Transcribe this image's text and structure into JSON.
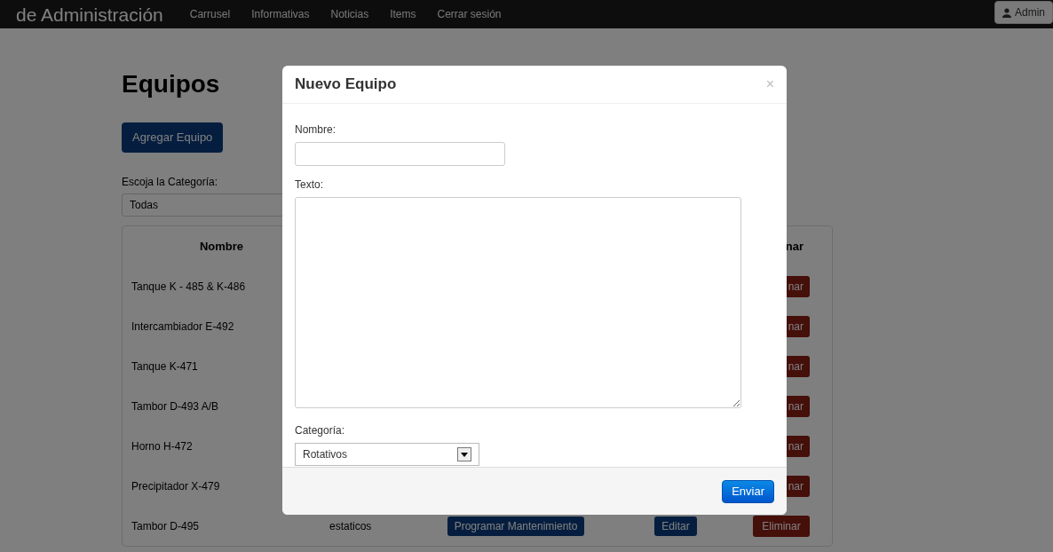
{
  "navbar": {
    "brand": "de Administración",
    "links": [
      "Carrusel",
      "Informativas",
      "Noticias",
      "Items",
      "Cerrar sesión"
    ],
    "user": "Admin"
  },
  "page": {
    "title": "Equipos",
    "add_button": "Agregar Equipo",
    "filter": {
      "label": "Escoja la Categoría:",
      "value": "Todas"
    }
  },
  "table": {
    "header": {
      "column_1": "Nombre",
      "column_5": "nar"
    },
    "rows": [
      {
        "name": "Tanque K - 485 & K-486",
        "delete": "nar"
      },
      {
        "name": "Intercambiador E-492",
        "delete": "nar"
      },
      {
        "name": "Tanque K-471",
        "delete": "nar"
      },
      {
        "name": "Tambor D-493 A/B",
        "delete": "nar"
      },
      {
        "name": "Horno H-472",
        "delete": "nar"
      },
      {
        "name": "Precipitador X-479",
        "delete": "nar"
      },
      {
        "name": "Tambor D-495",
        "category": "estaticos",
        "schedule": "Programar Mantenimiento",
        "edit": "Editar",
        "delete": "Eliminar"
      }
    ]
  },
  "modal": {
    "title": "Nuevo Equipo",
    "close": "×",
    "fields": [
      {
        "kind": "input",
        "label": "Nombre:"
      },
      {
        "kind": "textarea",
        "label": "Texto:"
      },
      {
        "kind": "select",
        "label": "Categoría:",
        "value": "Rotativos"
      }
    ],
    "submit": "Enviar"
  }
}
